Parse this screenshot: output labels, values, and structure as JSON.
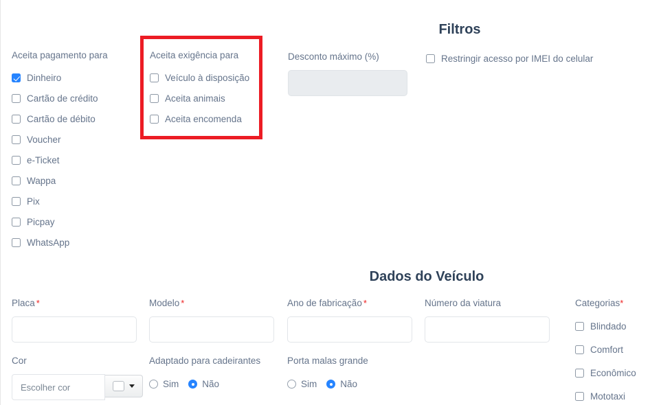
{
  "payments": {
    "label": "Aceita pagamento para",
    "options": [
      {
        "label": "Dinheiro",
        "checked": true
      },
      {
        "label": "Cartão de crédito",
        "checked": false
      },
      {
        "label": "Cartão de débito",
        "checked": false
      },
      {
        "label": "Voucher",
        "checked": false
      },
      {
        "label": "e-Ticket",
        "checked": false
      },
      {
        "label": "Wappa",
        "checked": false
      },
      {
        "label": "Pix",
        "checked": false
      },
      {
        "label": "Picpay",
        "checked": false
      },
      {
        "label": "WhatsApp",
        "checked": false
      }
    ]
  },
  "requirements": {
    "label": "Aceita exigência para",
    "highlight_color": "#ec1c24",
    "options": [
      {
        "label": "Veículo à disposição",
        "checked": false
      },
      {
        "label": "Aceita animais",
        "checked": false
      },
      {
        "label": "Aceita encomenda",
        "checked": false
      }
    ]
  },
  "filters": {
    "title": "Filtros",
    "discount_label": "Desconto máximo (%)",
    "discount_value": "",
    "imei_label": "Restringir acesso por IMEI do celular",
    "imei_checked": false
  },
  "vehicle": {
    "title": "Dados do Veículo",
    "plate_label": "Placa",
    "plate_required": "*",
    "plate_value": "",
    "model_label": "Modelo",
    "model_required": "*",
    "model_value": "",
    "year_label": "Ano de fabricação",
    "year_required": "*",
    "year_value": "",
    "number_label": "Número da viatura",
    "number_value": "",
    "color_label": "Cor",
    "color_placeholder": "Escolher cor",
    "color_value": "",
    "color_swatch": "#ffffff",
    "wheelchair_label": "Adaptado para cadeirantes",
    "wheelchair_yes": "Sim",
    "wheelchair_no": "Não",
    "wheelchair_selected": "Não",
    "trunk_label": "Porta malas grande",
    "trunk_yes": "Sim",
    "trunk_no": "Não",
    "trunk_selected": "Não",
    "categories_label": "Categorias",
    "categories_required": "*",
    "categories": [
      {
        "label": "Blindado",
        "checked": false
      },
      {
        "label": "Comfort",
        "checked": false
      },
      {
        "label": "Econômico",
        "checked": false
      },
      {
        "label": "Mototaxi",
        "checked": false
      }
    ]
  }
}
